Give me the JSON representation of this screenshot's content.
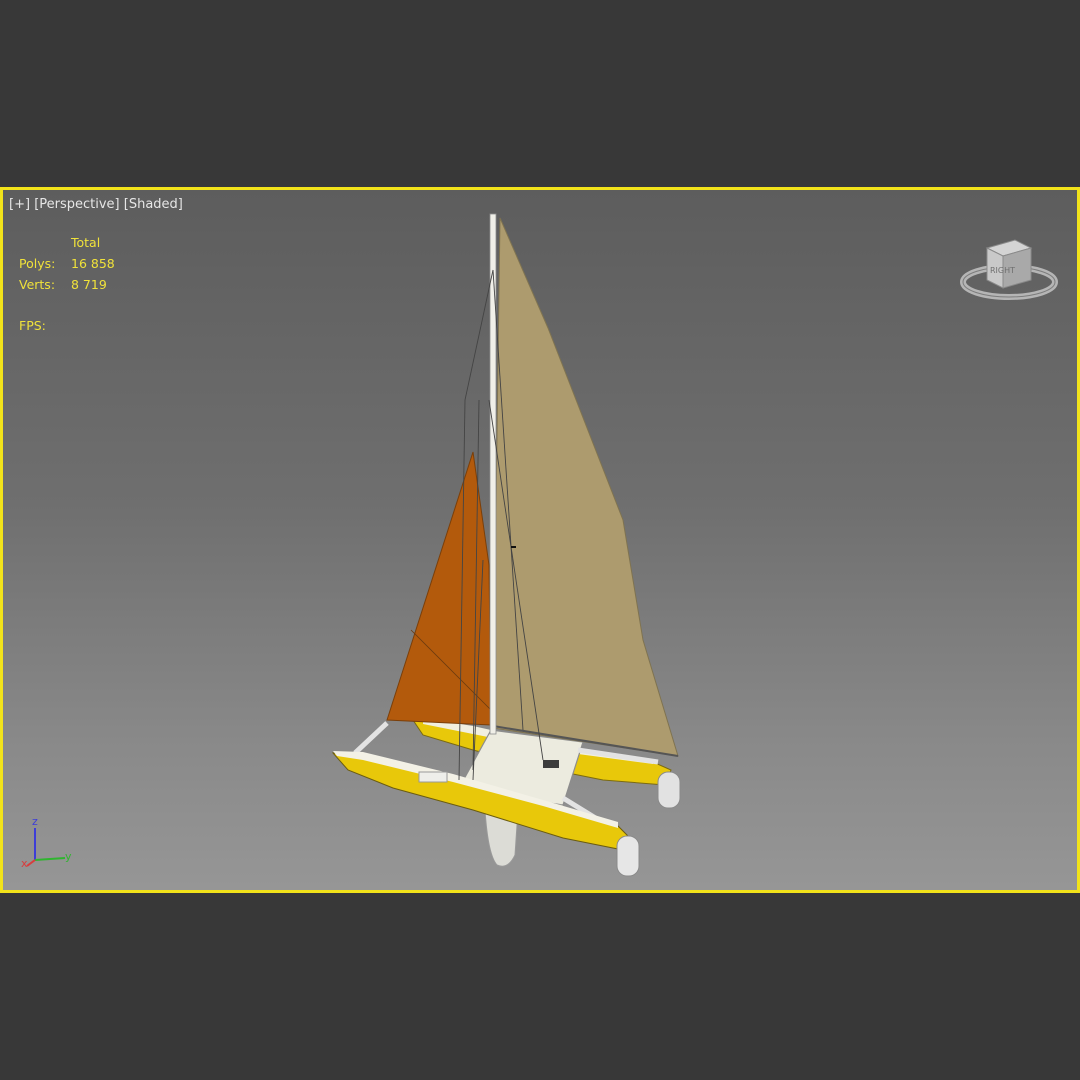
{
  "viewport": {
    "label": {
      "menu": "[+]",
      "view": "[Perspective]",
      "shading": "[Shaded]"
    },
    "stats": {
      "header": "Total",
      "polys_label": "Polys:",
      "polys_value": "16 858",
      "verts_label": "Verts:",
      "verts_value": "8 719",
      "fps_label": "FPS:"
    },
    "viewcube": {
      "face_label": "RIGHT"
    },
    "axis_gizmo": {
      "x": "x",
      "y": "y",
      "z": "z"
    },
    "colors": {
      "active_border": "#f2e31a",
      "stats_text": "#f0e23a",
      "mainsail": "#ad9b6e",
      "jib": "#b35a0c",
      "hull": "#e8c80a"
    }
  }
}
